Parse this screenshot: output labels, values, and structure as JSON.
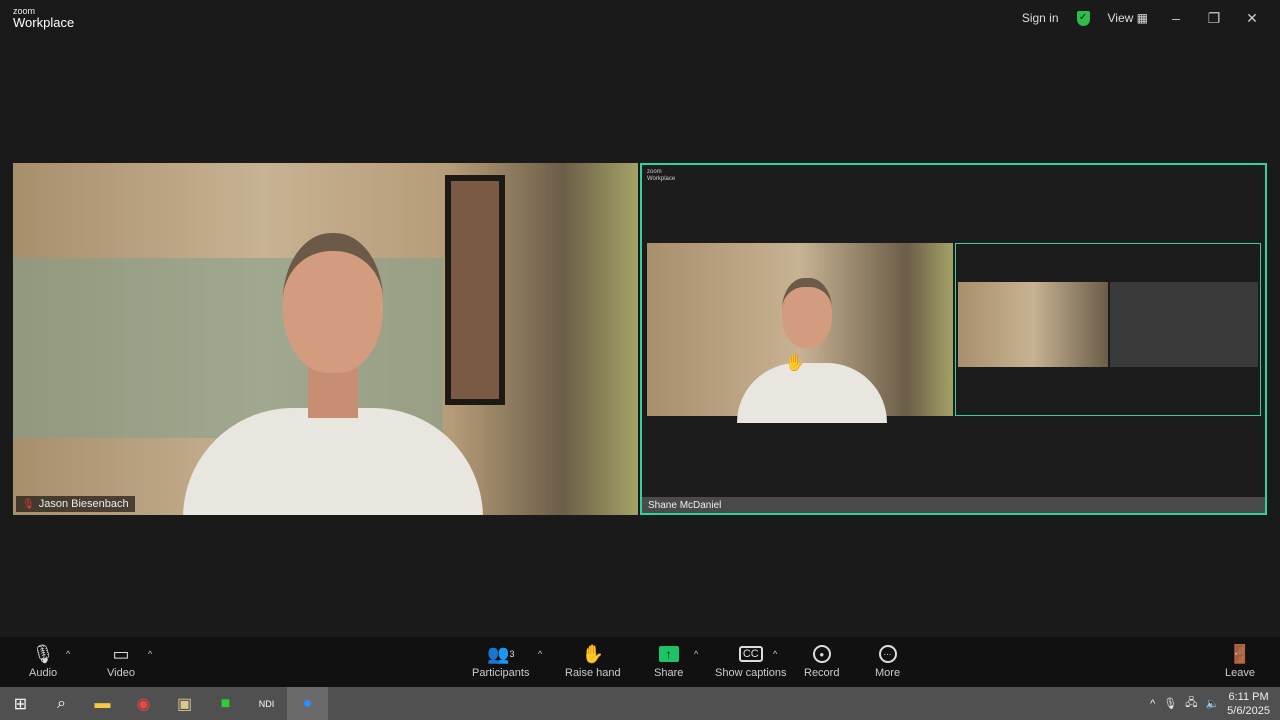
{
  "app": {
    "brand_small": "zoom",
    "brand": "Workplace",
    "sign_in": "Sign in",
    "view": "View"
  },
  "participants": [
    {
      "name": "Jason Biesenbach",
      "muted": true
    },
    {
      "name": "Shane McDaniel",
      "sharing": true
    }
  ],
  "toolbar": {
    "audio": "Audio",
    "video": "Video",
    "participants": "Participants",
    "participant_count": "3",
    "raise_hand": "Raise hand",
    "share": "Share",
    "captions": "Show captions",
    "record": "Record",
    "more": "More",
    "leave": "Leave"
  },
  "taskbar": {
    "time": "6:11 PM",
    "date": "5/6/2025"
  },
  "colors": {
    "active_speaker": "#2ed3a0",
    "share": "#20c268",
    "leave": "#e02828"
  }
}
